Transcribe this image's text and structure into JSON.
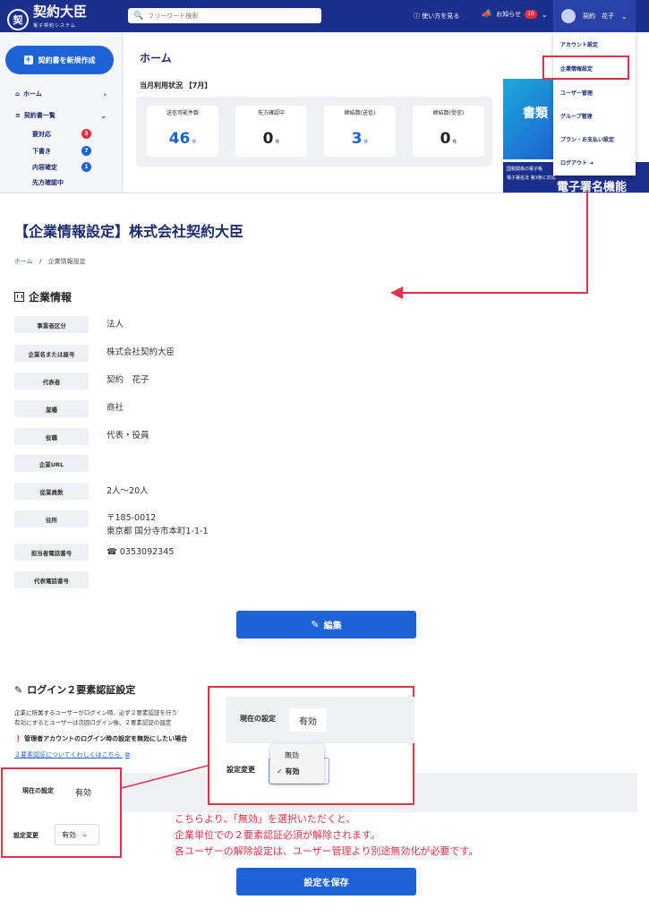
{
  "top": {
    "logo": {
      "mark": "契",
      "name": "契約大臣",
      "sub": "電子契約システム"
    },
    "search": {
      "placeholder": "フリーワード検索"
    },
    "howto": "使い方を見る",
    "notice": {
      "label": "お知らせ",
      "badge": "10"
    },
    "user": {
      "name": "契約　花子"
    },
    "sidebar": {
      "new_button": "契約書を新規作成",
      "home": "ホーム",
      "contracts": "契約書一覧",
      "subs": [
        {
          "label": "要対応",
          "count": "3",
          "color": "#e8303a"
        },
        {
          "label": "下書き",
          "count": "7",
          "color": "#1d63d6"
        },
        {
          "label": "内容確定",
          "count": "1",
          "color": "#1d63d6"
        },
        {
          "label": "先方確認中",
          "count": "",
          "color": ""
        }
      ]
    },
    "main": {
      "title": "ホーム",
      "usage_title": "当月利用状況 【7月】",
      "cards": [
        {
          "label": "送信可能件数",
          "value": "46",
          "unit": "件"
        },
        {
          "label": "先方確認中",
          "value": "0",
          "unit": "件"
        },
        {
          "label": "締結数(送信)",
          "value": "3",
          "unit": "件"
        },
        {
          "label": "締結数(受信)",
          "value": "0",
          "unit": "件"
        }
      ],
      "banner1": "書類",
      "banner2": {
        "line1": "国税関係の電子帳",
        "line2": "電子署名法 第3条に対応",
        "title": "電子署名機能"
      }
    },
    "dropdown": [
      "アカウント設定",
      "企業情報設定",
      "ユーザー管理",
      "グループ管理",
      "プラン・お支払い設定",
      "ログアウト"
    ]
  },
  "company": {
    "page_title": "【企業情報設定】株式会社契約大臣",
    "breadcrumb": {
      "home": "ホーム",
      "sep": "/",
      "current": "企業情報設定"
    },
    "section_title": "企業情報",
    "rows": [
      {
        "label": "事業者区分",
        "value": "法人"
      },
      {
        "label": "企業名または屋号",
        "value": "株式会社契約大臣"
      },
      {
        "label": "代表者",
        "value": "契約　花子"
      },
      {
        "label": "業種",
        "value": "商社"
      },
      {
        "label": "役職",
        "value": "代表・役員"
      },
      {
        "label": "企業URL",
        "value": ""
      },
      {
        "label": "従業員数",
        "value": "2人～20人"
      },
      {
        "label": "住所",
        "value": "〒185-0012",
        "value2": "東京都 国分寺市本町1-1-1"
      },
      {
        "label": "担当者電話番号",
        "value": "0353092345"
      },
      {
        "label": "代表電話番号",
        "value": ""
      }
    ],
    "edit_button": "編集"
  },
  "twofa": {
    "title": "ログイン２要素認証設定",
    "desc1": "企業に所属するユーザーがログイン時、必ず２要素認証を行う",
    "desc2": "有効にするとユーザーは次回ログイン後、２要素認証の設定",
    "note": "管理者アカウントのログイン時の設定を無効にしたい場合",
    "link": "２要素認証についてくわしくはこちら",
    "current_label": "現在の設定",
    "current_value": "有効",
    "change_label": "設定変更",
    "select_value": "有効",
    "options": [
      "無効",
      "有効"
    ],
    "save_button": "設定を保存"
  },
  "annotation": {
    "lines": [
      "こちらより、「無効」を選択いただくと、",
      "企業単位での２要素認証必須が解除されます。",
      "各ユーザーの解除設定は、ユーザー管理より別途無効化が必要です。"
    ]
  },
  "colors": {
    "brand_dark": "#1b2f8c",
    "primary": "#1d63d6",
    "highlight": "#e2314a"
  }
}
